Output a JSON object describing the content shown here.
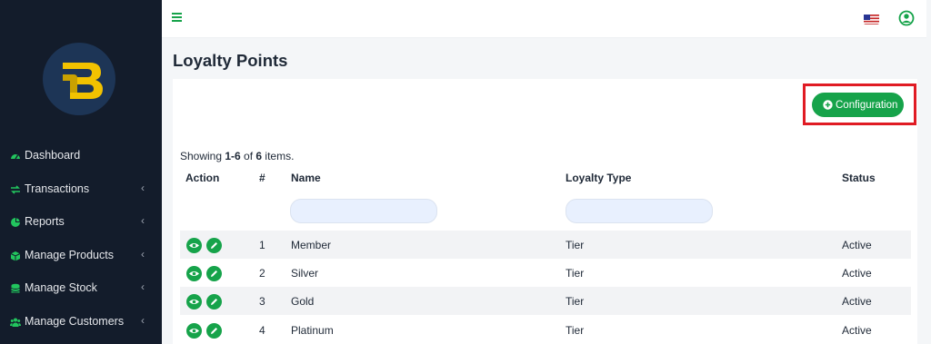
{
  "sidebar": {
    "items": [
      {
        "label": "Dashboard",
        "icon": "dashboard-icon",
        "has_chevron": false
      },
      {
        "label": "Transactions",
        "icon": "exchange-icon",
        "has_chevron": true
      },
      {
        "label": "Reports",
        "icon": "pie-chart-icon",
        "has_chevron": true
      },
      {
        "label": "Manage Products",
        "icon": "box-icon",
        "has_chevron": true
      },
      {
        "label": "Manage Stock",
        "icon": "database-icon",
        "has_chevron": true
      },
      {
        "label": "Manage Customers",
        "icon": "users-icon",
        "has_chevron": true
      }
    ],
    "chevron": "‹"
  },
  "page": {
    "title": "Loyalty Points"
  },
  "toolbar": {
    "config_label": "Configuration"
  },
  "summary": {
    "prefix": "Showing ",
    "range": "1-6",
    "mid": " of ",
    "total": "6",
    "suffix": " items."
  },
  "table": {
    "headers": {
      "action": "Action",
      "num": "#",
      "name": "Name",
      "type": "Loyalty Type",
      "status": "Status"
    },
    "rows": [
      {
        "num": "1",
        "name": "Member",
        "type": "Tier",
        "status": "Active"
      },
      {
        "num": "2",
        "name": "Silver",
        "type": "Tier",
        "status": "Active"
      },
      {
        "num": "3",
        "name": "Gold",
        "type": "Tier",
        "status": "Active"
      },
      {
        "num": "4",
        "name": "Platinum",
        "type": "Tier",
        "status": "Active"
      }
    ]
  },
  "colors": {
    "accent": "#16a34a",
    "sidebar_bg": "#131c2b",
    "highlight": "#e01b24"
  }
}
